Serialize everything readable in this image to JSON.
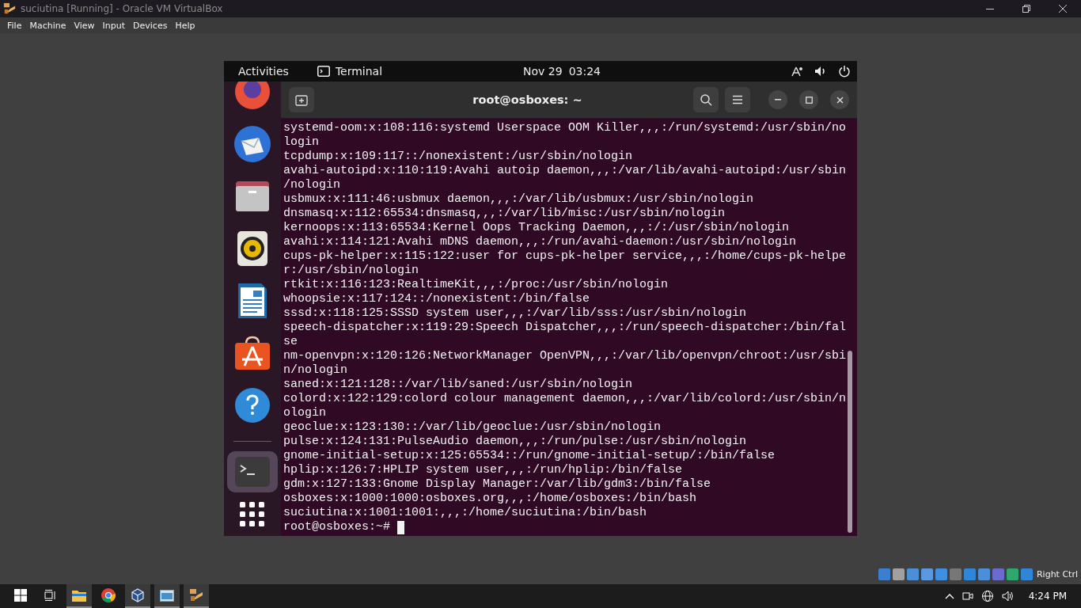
{
  "window": {
    "title": "suciutina [Running] - Oracle VM VirtualBox"
  },
  "menu": [
    "File",
    "Machine",
    "View",
    "Input",
    "Devices",
    "Help"
  ],
  "guest": {
    "top_bar": {
      "activities": "Activities",
      "app": "Terminal",
      "date": "Nov 29",
      "time": "03:24"
    },
    "dock": {
      "favorites": [
        {
          "kind": "browser",
          "selected": false
        },
        {
          "kind": "mail",
          "selected": false
        },
        {
          "kind": "files",
          "selected": false
        },
        {
          "kind": "music",
          "selected": false
        },
        {
          "kind": "writer",
          "selected": false
        },
        {
          "kind": "store",
          "selected": false
        },
        {
          "kind": "help",
          "selected": false
        }
      ],
      "running": [
        {
          "kind": "terminal",
          "selected": true
        }
      ]
    },
    "terminal": {
      "title": "root@osboxes: ~",
      "lines": [
        "systemd-oom:x:108:116:systemd Userspace OOM Killer,,,:/run/systemd:/usr/sbin/no",
        "login",
        "tcpdump:x:109:117::/nonexistent:/usr/sbin/nologin",
        "avahi-autoipd:x:110:119:Avahi autoip daemon,,,:/var/lib/avahi-autoipd:/usr/sbin",
        "/nologin",
        "usbmux:x:111:46:usbmux daemon,,,:/var/lib/usbmux:/usr/sbin/nologin",
        "dnsmasq:x:112:65534:dnsmasq,,,:/var/lib/misc:/usr/sbin/nologin",
        "kernoops:x:113:65534:Kernel Oops Tracking Daemon,,,:/:/usr/sbin/nologin",
        "avahi:x:114:121:Avahi mDNS daemon,,,:/run/avahi-daemon:/usr/sbin/nologin",
        "cups-pk-helper:x:115:122:user for cups-pk-helper service,,,:/home/cups-pk-helpe",
        "r:/usr/sbin/nologin",
        "rtkit:x:116:123:RealtimeKit,,,:/proc:/usr/sbin/nologin",
        "whoopsie:x:117:124::/nonexistent:/bin/false",
        "sssd:x:118:125:SSSD system user,,,:/var/lib/sss:/usr/sbin/nologin",
        "speech-dispatcher:x:119:29:Speech Dispatcher,,,:/run/speech-dispatcher:/bin/fal",
        "se",
        "nm-openvpn:x:120:126:NetworkManager OpenVPN,,,:/var/lib/openvpn/chroot:/usr/sbi",
        "n/nologin",
        "saned:x:121:128::/var/lib/saned:/usr/sbin/nologin",
        "colord:x:122:129:colord colour management daemon,,,:/var/lib/colord:/usr/sbin/n",
        "ologin",
        "geoclue:x:123:130::/var/lib/geoclue:/usr/sbin/nologin",
        "pulse:x:124:131:PulseAudio daemon,,,:/run/pulse:/usr/sbin/nologin",
        "gnome-initial-setup:x:125:65534::/run/gnome-initial-setup/:/bin/false",
        "hplip:x:126:7:HPLIP system user,,,:/run/hplip:/bin/false",
        "gdm:x:127:133:Gnome Display Manager:/var/lib/gdm3:/bin/false",
        "osboxes:x:1000:1000:osboxes.org,,,:/home/osboxes:/bin/bash",
        "suciutina:x:1001:1001:,,,:/home/suciutina:/bin/bash"
      ],
      "prompt": "root@osboxes:~#"
    }
  },
  "status_bar": {
    "host_key": "Right Ctrl"
  },
  "taskbar": {
    "apps": [
      {
        "kind": "folder",
        "open": true
      },
      {
        "kind": "chrome",
        "open": false
      },
      {
        "kind": "cube",
        "open": true
      },
      {
        "kind": "window",
        "open": true
      },
      {
        "kind": "vbox",
        "open": true
      }
    ],
    "clock": "4:24 PM"
  }
}
